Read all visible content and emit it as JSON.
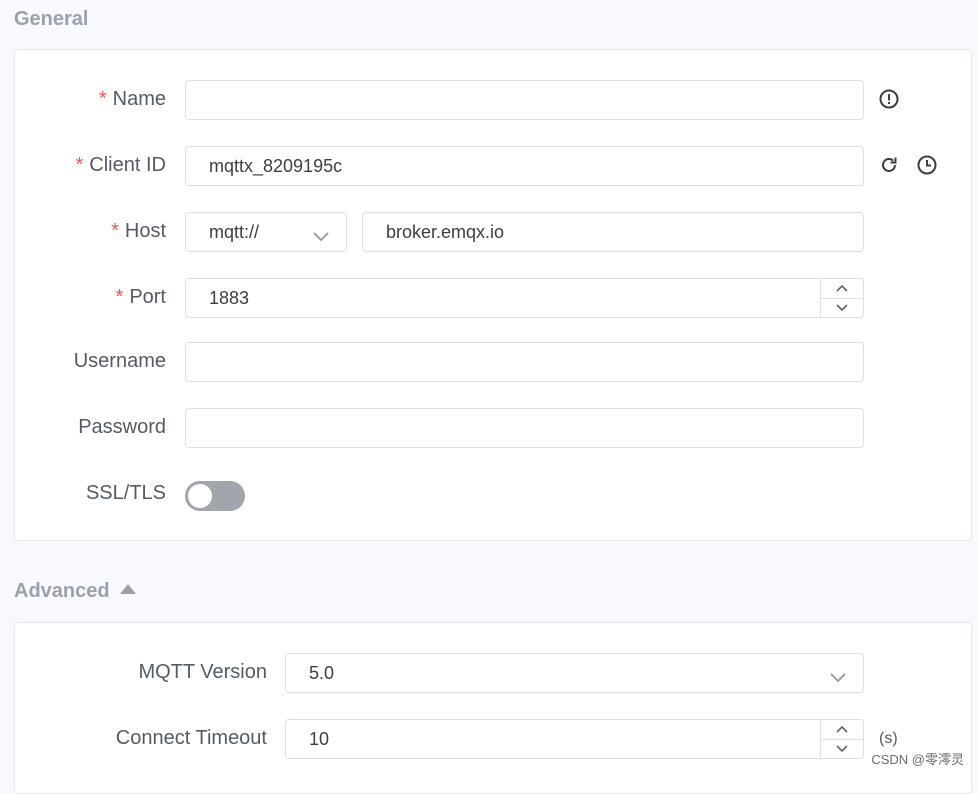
{
  "general": {
    "title": "General",
    "name": {
      "label": "Name",
      "required_mark": "*",
      "value": ""
    },
    "client_id": {
      "label": "Client ID",
      "required_mark": "*",
      "value": "mqttx_8209195c"
    },
    "host": {
      "label": "Host",
      "required_mark": "*",
      "protocol": "mqtt://",
      "value": "broker.emqx.io"
    },
    "port": {
      "label": "Port",
      "required_mark": "*",
      "value": "1883"
    },
    "username": {
      "label": "Username",
      "value": ""
    },
    "password": {
      "label": "Password",
      "value": ""
    },
    "ssl": {
      "label": "SSL/TLS",
      "enabled": false
    }
  },
  "advanced": {
    "title": "Advanced",
    "mqtt_version": {
      "label": "MQTT Version",
      "value": "5.0"
    },
    "connect_timeout": {
      "label": "Connect Timeout",
      "value": "10",
      "unit": "(s)"
    }
  },
  "watermark": "CSDN @零澪灵",
  "icons": {
    "name_info": "exclamation-circle-icon",
    "refresh": "refresh-icon",
    "history": "clock-icon",
    "dropdown": "chevron-down-icon",
    "step_up": "chevron-up-icon",
    "step_down": "chevron-down-icon",
    "collapse": "caret-up-icon"
  }
}
